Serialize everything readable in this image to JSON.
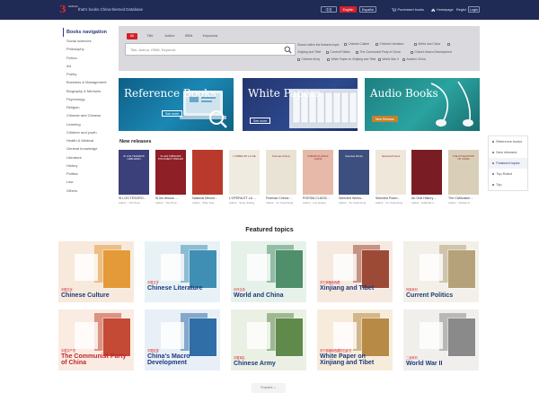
{
  "header": {
    "logo_mark": "3",
    "logo_text": "theBooks",
    "site_name": "that's books China-themed Database",
    "lang_buttons": [
      "中文",
      "English",
      "Español"
    ],
    "active_lang": "English",
    "purchased_label": "Purchased books",
    "homepage_label": "Homepage",
    "register_label": "Regist",
    "login_label": "Login"
  },
  "sidebar": {
    "title": "Books navigation",
    "items": [
      "Social sciences",
      "Philosophy",
      "Fiction",
      "Art",
      "Poetry",
      "Business & Management",
      "Biography & Memoirs",
      "Psychology",
      "Religion",
      "Chinese and Chinese",
      "Learning",
      "Children and youth",
      "Health & Medical",
      "General knowledge",
      "Literature",
      "History",
      "Politics",
      "Law",
      "Others"
    ]
  },
  "search": {
    "tabs": [
      "All",
      "Title",
      "Author",
      "ISBN",
      "Keywords"
    ],
    "active_tab": "All",
    "placeholder": "Title, Author, ISBN, Keyword",
    "filters_title": "Search within the featured topic:",
    "filters": [
      "Chinese Culture",
      "Chinese Literature",
      "World and China",
      "Xinjiang and Tibet",
      "Current Politics",
      "The Communist Party of China",
      "China's Macro Development",
      "Chinese Army",
      "White Paper on Xinjiang and Tibet",
      "World War II",
      "Another China"
    ]
  },
  "banners": [
    {
      "title": "Reference Books",
      "button": "See more"
    },
    {
      "title": "White Papers",
      "button": "See more"
    },
    {
      "title": "Audio Books",
      "button": "New Release"
    }
  ],
  "new_releases": {
    "title": "New releases",
    "books": [
      {
        "title": "SI LOS TESORO...",
        "author": "Author：The Prod...",
        "color": "#3b3f7a",
        "cover": "SI LOS TESOROS HABLARAN"
      },
      {
        "title": "Si les trésors ...",
        "author": "Author：The Prod...",
        "color": "#8e1f27",
        "cover": "SI LES TRÉSORS POUVAIENT PARLER"
      },
      {
        "title": "National Memor...",
        "author": "Author：Zhao Hog...",
        "color": "#b93a2c",
        "cover": ""
      },
      {
        "title": "L'OPÉRA ET LA ...",
        "author": "Author：Song Jinfang",
        "color": "#f0ebe1",
        "cover": "L'OPÉRA ET LA VIE"
      },
      {
        "title": "Poemas Chinos ...",
        "author": "Author：Xu Yuanchong",
        "color": "#e9e3d6",
        "cover": "Poemas Chinos"
      },
      {
        "title": "POESÍA CLÁSIC...",
        "author": "Author：Luo Guang",
        "color": "#e6b9a9",
        "cover": "POESÍA CLÁSICA CHINA"
      },
      {
        "title": "Selected Works...",
        "author": "Author：Xu Yuanchong",
        "color": "#3c4f7e",
        "cover": "Selected Works"
      },
      {
        "title": "Selected Poem...",
        "author": "Author：Xu Yuanchong",
        "color": "#efe7da",
        "cover": "Selected Poems"
      },
      {
        "title": "An Oral History ...",
        "author": "Author：Editorial C...",
        "color": "#7a1c24",
        "cover": ""
      },
      {
        "title": "The Civilization ...",
        "author": "Author：Herbert A...",
        "color": "#d9cfb8",
        "cover": "THE CIVILIZATION OF CHINA"
      }
    ]
  },
  "float_menu": {
    "items": [
      "Reference books",
      "New releases",
      "Featured topics",
      "Top-Rated",
      "Top"
    ],
    "active": "Featured topics"
  },
  "featured": {
    "title": "Featured topics",
    "topics": [
      {
        "zh": "中国文化",
        "en": "Chinese Culture",
        "bg": "#f7e9dc",
        "accent": "#e59a3a"
      },
      {
        "zh": "中国文学",
        "en": "Chinese Literature",
        "bg": "#e8f2f6",
        "accent": "#3f8fb4"
      },
      {
        "zh": "中外交流",
        "en": "World and China",
        "bg": "#e6f1ea",
        "accent": "#4f8f6c"
      },
      {
        "zh": "关于新疆和西藏",
        "en": "Xinjiang and Tibet",
        "bg": "#f6e9e0",
        "accent": "#9c4a36"
      },
      {
        "zh": "时政系列",
        "en": "Current Politics",
        "bg": "#f2f0e8",
        "accent": "#b5a27a"
      },
      {
        "zh": "中国共产党",
        "en": "The Communist Party of China",
        "bg": "#faece2",
        "accent": "#c44a35"
      },
      {
        "zh": "中国宏观",
        "en": "China's Macro Development",
        "bg": "#e8eff7",
        "accent": "#2f6ea6"
      },
      {
        "zh": "中国军队",
        "en": "Chinese Army",
        "bg": "#eaf1e4",
        "accent": "#5f8a4c"
      },
      {
        "zh": "关于新疆和西藏的白皮书",
        "en": "White Paper on Xinjiang and Tibet",
        "bg": "#f7ecdc",
        "accent": "#b78a45"
      },
      {
        "zh": "二战系列",
        "en": "World War II",
        "bg": "#f1efec",
        "accent": "#8a8a8a"
      }
    ]
  },
  "expand_label": "Expand"
}
